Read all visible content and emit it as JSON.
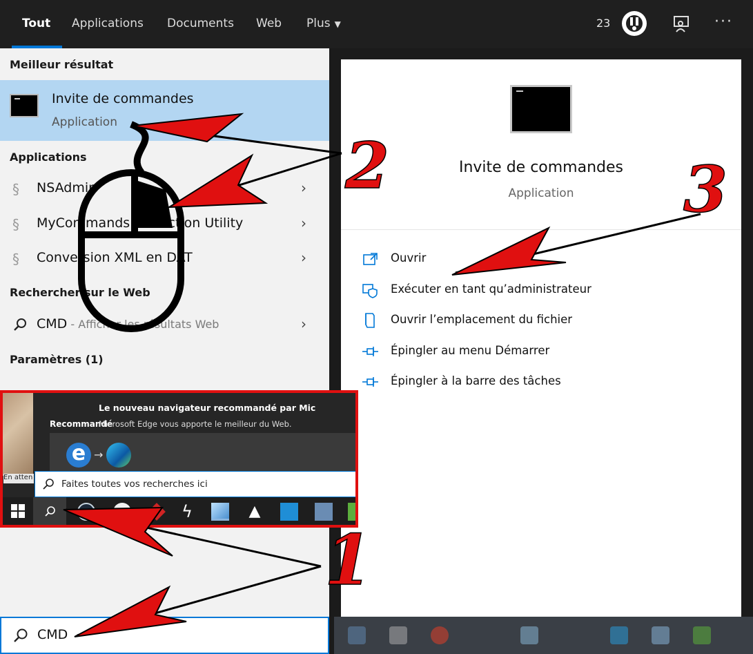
{
  "tabs": [
    {
      "label": "Tout",
      "active": true
    },
    {
      "label": "Applications"
    },
    {
      "label": "Documents"
    },
    {
      "label": "Web"
    },
    {
      "label": "Plus"
    }
  ],
  "header": {
    "badge_count": "23"
  },
  "left": {
    "best_header": "Meilleur résultat",
    "best": {
      "title": "Invite de commandes",
      "subtitle": "Application"
    },
    "apps_header": "Applications",
    "apps": [
      {
        "label": "NSAdmin"
      },
      {
        "label": "MyCommands Protection Utility"
      },
      {
        "label": "Conversion XML en DAT"
      }
    ],
    "web_header": "Rechercher sur le Web",
    "web_item": {
      "term": "CMD",
      "suffix": " - Afficher les résultats Web"
    },
    "settings_header": "Paramètres (1)"
  },
  "right": {
    "title": "Invite de commandes",
    "subtitle": "Application",
    "actions": [
      {
        "label": "Ouvrir",
        "icon": "open-icon"
      },
      {
        "label": "Exécuter en tant qu’administrateur",
        "icon": "shield-icon"
      },
      {
        "label": "Ouvrir l’emplacement du fichier",
        "icon": "file-location-icon"
      },
      {
        "label": "Épingler au menu Démarrer",
        "icon": "pin-icon"
      },
      {
        "label": "Épingler à la barre des tâches",
        "icon": "pin-icon"
      }
    ]
  },
  "bottom_search": {
    "value": "CMD"
  },
  "inset": {
    "photo_label": "En atten",
    "recommended": "Recommandé",
    "card_title": "Le nouveau navigateur recommandé par Mic",
    "card_sub": "Microsoft Edge vous apporte le meilleur du Web.",
    "search_placeholder": "Faites toutes vos recherches ici"
  },
  "annotations": {
    "step1": "1",
    "step2": "2",
    "step3": "3"
  },
  "colors": {
    "accent": "#0078d7",
    "selection": "#b3d6f2",
    "annotation_red": "#e01010"
  }
}
